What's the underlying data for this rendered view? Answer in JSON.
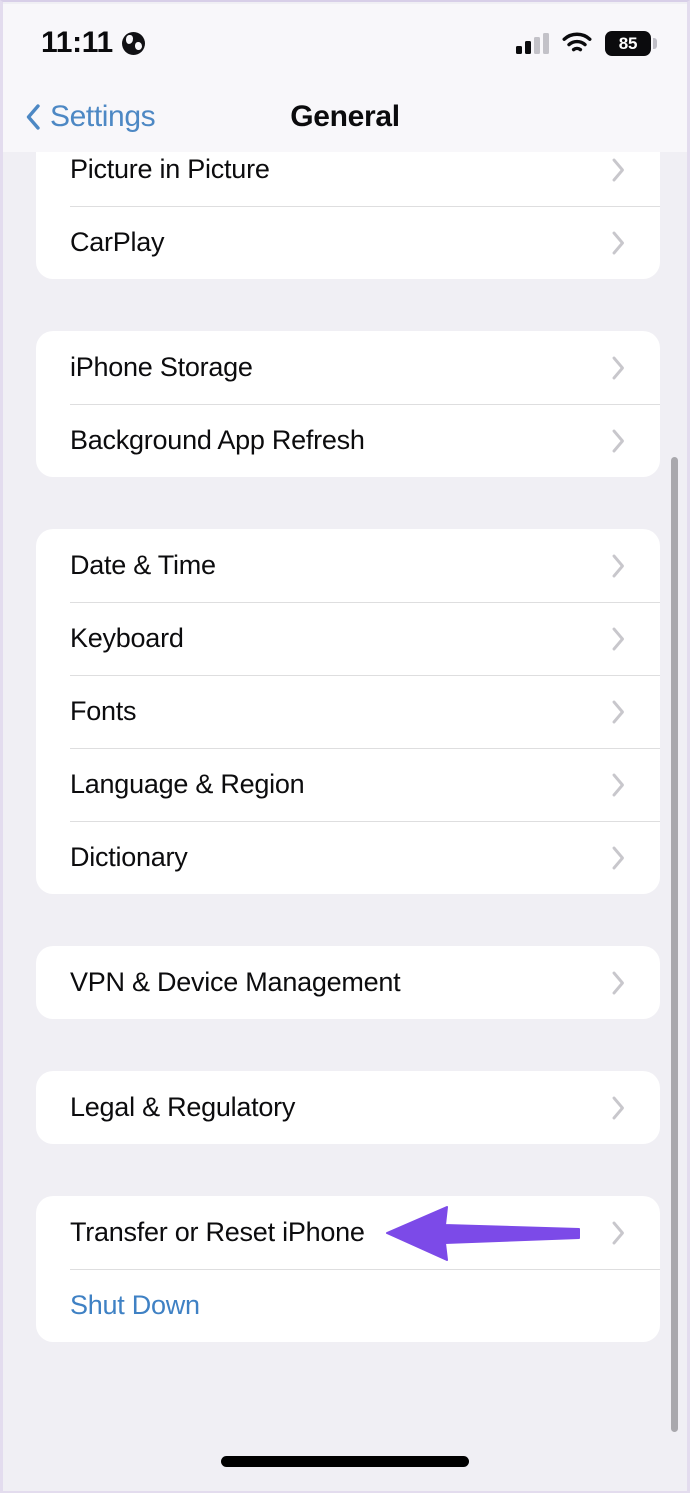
{
  "status_bar": {
    "time": "11:11",
    "location_icon": "globe-icon",
    "cellular_icon": "cellular-signal-icon",
    "cellular_bars_filled": 2,
    "cellular_bars_total": 4,
    "wifi_icon": "wifi-icon",
    "battery_icon": "battery-icon",
    "battery_percent": "85"
  },
  "nav_bar": {
    "back_icon": "chevron-left-icon",
    "back_label": "Settings",
    "title": "General"
  },
  "groups": [
    {
      "id": "media-group",
      "clipped_top": true,
      "rows": [
        {
          "label": "Picture in Picture",
          "type": "disclosure",
          "accessory_icon": "chevron-right-icon"
        },
        {
          "label": "CarPlay",
          "type": "disclosure",
          "accessory_icon": "chevron-right-icon"
        }
      ]
    },
    {
      "id": "storage-group",
      "clipped_top": false,
      "rows": [
        {
          "label": "iPhone Storage",
          "type": "disclosure",
          "accessory_icon": "chevron-right-icon"
        },
        {
          "label": "Background App Refresh",
          "type": "disclosure",
          "accessory_icon": "chevron-right-icon"
        }
      ]
    },
    {
      "id": "localization-group",
      "clipped_top": false,
      "rows": [
        {
          "label": "Date & Time",
          "type": "disclosure",
          "accessory_icon": "chevron-right-icon"
        },
        {
          "label": "Keyboard",
          "type": "disclosure",
          "accessory_icon": "chevron-right-icon"
        },
        {
          "label": "Fonts",
          "type": "disclosure",
          "accessory_icon": "chevron-right-icon"
        },
        {
          "label": "Language & Region",
          "type": "disclosure",
          "accessory_icon": "chevron-right-icon"
        },
        {
          "label": "Dictionary",
          "type": "disclosure",
          "accessory_icon": "chevron-right-icon"
        }
      ]
    },
    {
      "id": "vpn-group",
      "clipped_top": false,
      "rows": [
        {
          "label": "VPN & Device Management",
          "type": "disclosure",
          "accessory_icon": "chevron-right-icon"
        }
      ]
    },
    {
      "id": "legal-group",
      "clipped_top": false,
      "rows": [
        {
          "label": "Legal & Regulatory",
          "type": "disclosure",
          "accessory_icon": "chevron-right-icon"
        }
      ]
    },
    {
      "id": "reset-group",
      "clipped_top": false,
      "rows": [
        {
          "label": "Transfer or Reset iPhone",
          "type": "disclosure",
          "accessory_icon": "chevron-right-icon"
        },
        {
          "label": "Shut Down",
          "type": "action",
          "accessory_icon": "none"
        }
      ]
    }
  ],
  "annotation": {
    "name": "highlight-arrow",
    "shape": "left-arrow",
    "points_to": "Transfer or Reset iPhone",
    "color": "#7c4ae8"
  },
  "scrollbar": {
    "name": "vertical-scroll-indicator",
    "color": "#a9a8ad"
  },
  "home_indicator": {
    "name": "home-indicator",
    "color": "#000000"
  },
  "colors": {
    "page_background": "#f0eff4",
    "card_background": "#ffffff",
    "primary_text": "#0c0c0e",
    "link_blue": "#3f81c4",
    "back_blue": "#4d88c4",
    "separator": "#dededf",
    "chevron": "#c8c7cc",
    "accent_purple": "#7c4ae8"
  }
}
